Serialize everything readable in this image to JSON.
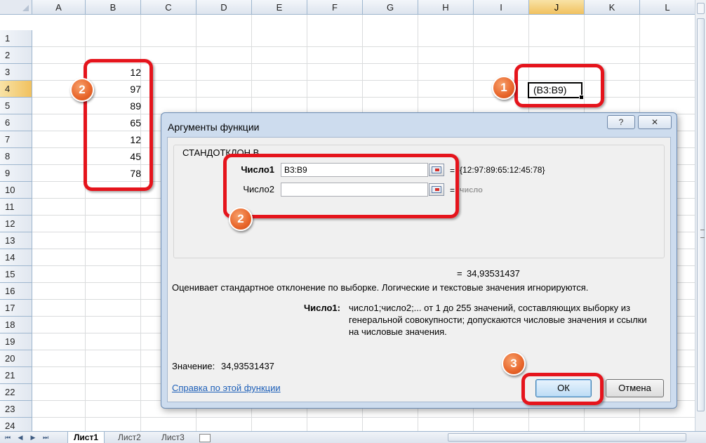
{
  "sheet": {
    "columns": [
      "A",
      "B",
      "C",
      "D",
      "E",
      "F",
      "G",
      "H",
      "I",
      "J",
      "K",
      "L"
    ],
    "active_column": "J",
    "rows": [
      "1",
      "2",
      "3",
      "4",
      "5",
      "6",
      "7",
      "8",
      "9",
      "10",
      "11",
      "12",
      "13",
      "14",
      "15",
      "16",
      "17",
      "18",
      "19",
      "20",
      "21",
      "22",
      "23",
      "24"
    ],
    "active_row": "4",
    "column_b_values": [
      "12",
      "97",
      "89",
      "65",
      "12",
      "45",
      "78"
    ],
    "j4_formula": "(B3:B9)"
  },
  "tabs": {
    "nav": [
      "⏮",
      "◀",
      "▶",
      "⏭"
    ],
    "sheets": [
      "Лист1",
      "Лист2",
      "Лист3"
    ],
    "active_sheet": "Лист1"
  },
  "badges": {
    "one": "1",
    "two": "2",
    "three": "3"
  },
  "dialog": {
    "title": "Аргументы функции",
    "help_button": "?",
    "close_button": "✕",
    "function_name": "СТАНДОТКЛОН.В",
    "arg1_label": "Число1",
    "arg1_value": "B3:B9",
    "arg1_result": "{12:97:89:65:12:45:78}",
    "arg2_label": "Число2",
    "arg2_value": "",
    "arg2_result": "число",
    "equals_sign": "=",
    "formula_result": "34,93531437",
    "description": "Оценивает стандартное отклонение по выборке. Логические и текстовые значения игнорируются.",
    "param_name": "Число1:",
    "param_desc_1": "число1;число2;... от 1 до 255 значений, составляющих выборку из",
    "param_desc_2": "генеральной совокупности; допускаются числовые значения и ссылки",
    "param_desc_3": "на числовые значения.",
    "value_label": "Значение:",
    "value": "34,93531437",
    "help_link": "Справка по этой функции",
    "ok_button": "ОК",
    "cancel_button": "Отмена"
  },
  "colors": {
    "annotation_red": "#e5141c",
    "badge_orange": "#e8652a",
    "dialog_frame": "#cddcee",
    "link_blue": "#1d5fb8"
  }
}
